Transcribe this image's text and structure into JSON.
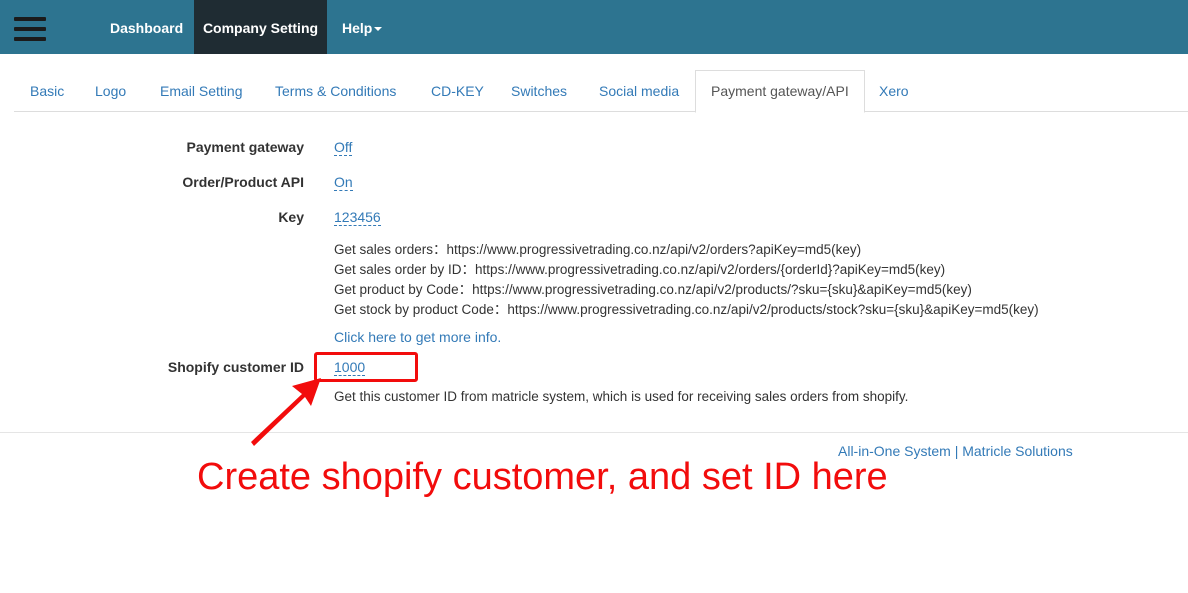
{
  "navbar": {
    "items": [
      {
        "label": "Dashboard"
      },
      {
        "label": "Company Setting"
      },
      {
        "label": "Help"
      }
    ]
  },
  "tabs": [
    {
      "label": "Basic"
    },
    {
      "label": "Logo"
    },
    {
      "label": "Email Setting"
    },
    {
      "label": "Terms & Conditions"
    },
    {
      "label": "CD-KEY"
    },
    {
      "label": "Switches"
    },
    {
      "label": "Social media"
    },
    {
      "label": "Payment gateway/API",
      "active": true
    },
    {
      "label": "Xero"
    }
  ],
  "form": {
    "payment_gateway": {
      "label": "Payment gateway",
      "value": "Off"
    },
    "order_api": {
      "label": "Order/Product API",
      "value": "On"
    },
    "key": {
      "label": "Key",
      "value": "123456"
    },
    "api_info": [
      "Get sales orders：https://www.progressivetrading.co.nz/api/v2/orders?apiKey=md5(key)",
      "Get sales order by ID：https://www.progressivetrading.co.nz/api/v2/orders/{orderId}?apiKey=md5(key)",
      "Get product by Code：https://www.progressivetrading.co.nz/api/v2/products/?sku={sku}&apiKey=md5(key)",
      "Get stock by product Code：https://www.progressivetrading.co.nz/api/v2/products/stock?sku={sku}&apiKey=md5(key)"
    ],
    "more_info_link": "Click here to get more info.",
    "shopify_customer": {
      "label": "Shopify customer ID",
      "value": "1000",
      "help": "Get this customer ID from matricle system, which is used for receiving sales orders from shopify."
    }
  },
  "footer": {
    "left": "All-in-One System",
    "separator": "|",
    "right": "Matricle Solutions"
  },
  "annotation": {
    "text": "Create shopify customer, and set ID here",
    "color": "#f20c0c"
  },
  "colors": {
    "navbar_bg": "#2d7490",
    "navbar_active_bg": "#1f2c33",
    "link": "#337ab7"
  }
}
